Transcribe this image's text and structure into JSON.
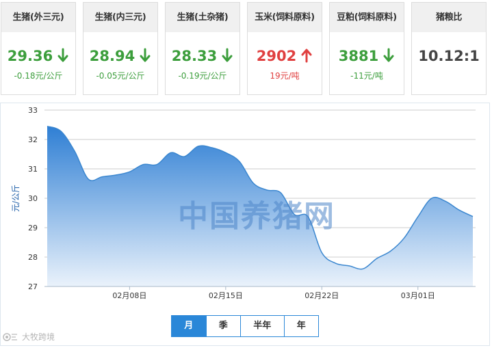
{
  "cards": [
    {
      "title": "生猪(外三元)",
      "price": "29.36",
      "direction": "down",
      "change": "-0.18元/公斤"
    },
    {
      "title": "生猪(内三元)",
      "price": "28.94",
      "direction": "down",
      "change": "-0.05元/公斤"
    },
    {
      "title": "生猪(土杂猪)",
      "price": "28.33",
      "direction": "down",
      "change": "-0.19元/公斤"
    },
    {
      "title": "玉米(饲料原料)",
      "price": "2902",
      "direction": "up",
      "change": "19元/吨"
    },
    {
      "title": "豆粕(饲料原料)",
      "price": "3881",
      "direction": "down",
      "change": "-11元/吨"
    },
    {
      "title": "猪粮比",
      "price": "10.12:1",
      "direction": "none",
      "change": ""
    }
  ],
  "colors": {
    "down": "#3c9e3c",
    "up": "#e04040",
    "accent": "#2a87d8",
    "area_top": "#2f7fd4",
    "area_bottom": "#eaf2fb",
    "line": "#3a86cf",
    "grid": "#cccccc",
    "watermark": "#4d85c8"
  },
  "chart_data": {
    "type": "area",
    "title": "",
    "xlabel": "",
    "ylabel": "元/公斤",
    "ylim": [
      27,
      33
    ],
    "yticks": [
      27,
      28,
      29,
      30,
      31,
      32,
      33
    ],
    "grid": true,
    "x": [
      "02-02",
      "02-03",
      "02-04",
      "02-05",
      "02-06",
      "02-07",
      "02-08",
      "02-09",
      "02-10",
      "02-11",
      "02-12",
      "02-13",
      "02-14",
      "02-15",
      "02-16",
      "02-17",
      "02-18",
      "02-19",
      "02-20",
      "02-21",
      "02-22",
      "02-23",
      "02-24",
      "02-25",
      "02-26",
      "02-27",
      "02-28",
      "03-01",
      "03-02",
      "03-03",
      "03-04",
      "03-05"
    ],
    "values": [
      32.45,
      32.28,
      31.6,
      30.65,
      30.73,
      30.79,
      30.9,
      31.15,
      31.15,
      31.55,
      31.42,
      31.77,
      31.72,
      31.55,
      31.25,
      30.52,
      30.28,
      30.19,
      29.45,
      29.37,
      28.15,
      27.79,
      27.7,
      27.6,
      27.95,
      28.2,
      28.65,
      29.37,
      30.0,
      29.9,
      29.6,
      29.38
    ],
    "xtick_labels": [
      {
        "at": "02-08",
        "label": "02月08日"
      },
      {
        "at": "02-15",
        "label": "02月15日"
      },
      {
        "at": "02-22",
        "label": "02月22日"
      },
      {
        "at": "03-01",
        "label": "03月01日"
      }
    ],
    "watermark": "中国养猪网"
  },
  "range_tabs": [
    {
      "label": "月",
      "active": true
    },
    {
      "label": "季",
      "active": false
    },
    {
      "label": "半年",
      "active": false
    },
    {
      "label": "年",
      "active": false
    }
  ],
  "footer": {
    "credit": "大牧跨境"
  }
}
